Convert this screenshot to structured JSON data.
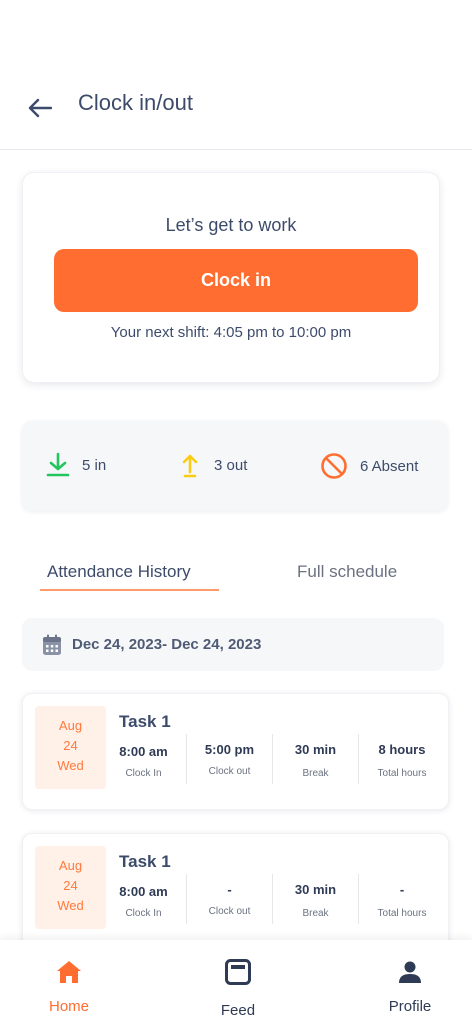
{
  "header": {
    "title": "Clock in/out"
  },
  "clock_card": {
    "greeting": "Let’s get to work",
    "button_label": "Clock in",
    "next_shift": "Your next shift: 4:05 pm to 10:00 pm"
  },
  "stats": [
    {
      "label": "5 in",
      "icon": "download-icon",
      "color": "#22c55e"
    },
    {
      "label": "3 out",
      "icon": "upload-icon",
      "color": "#facc15"
    },
    {
      "label": "6 Absent",
      "icon": "block-icon",
      "color": "#ff6e30"
    }
  ],
  "tabs": [
    {
      "label": "Attendance History",
      "active": true
    },
    {
      "label": "Full schedule",
      "active": false
    }
  ],
  "date_range": "Dec 24, 2023- Dec 24, 2023",
  "tasks": [
    {
      "date": {
        "month": "Aug",
        "day": "24",
        "weekday": "Wed"
      },
      "title": "Task 1",
      "columns": [
        {
          "value": "8:00 am",
          "label": "Clock In"
        },
        {
          "value": "5:00 pm",
          "label": "Clock out"
        },
        {
          "value": "30 min",
          "label": "Break"
        },
        {
          "value": "8 hours",
          "label": "Total hours"
        }
      ]
    },
    {
      "date": {
        "month": "Aug",
        "day": "24",
        "weekday": "Wed"
      },
      "title": "Task 1",
      "columns": [
        {
          "value": "8:00 am",
          "label": "Clock In"
        },
        {
          "value": "-",
          "label": "Clock out"
        },
        {
          "value": "30 min",
          "label": "Break"
        },
        {
          "value": "-",
          "label": "Total hours"
        }
      ]
    }
  ],
  "bottom_nav": [
    {
      "label": "Home",
      "icon": "home-icon",
      "active": true
    },
    {
      "label": "Feed",
      "icon": "feed-icon",
      "active": false
    },
    {
      "label": "Profile",
      "icon": "profile-icon",
      "active": false
    }
  ],
  "colors": {
    "accent": "#ff6e30",
    "text": "#3d4b6b"
  }
}
